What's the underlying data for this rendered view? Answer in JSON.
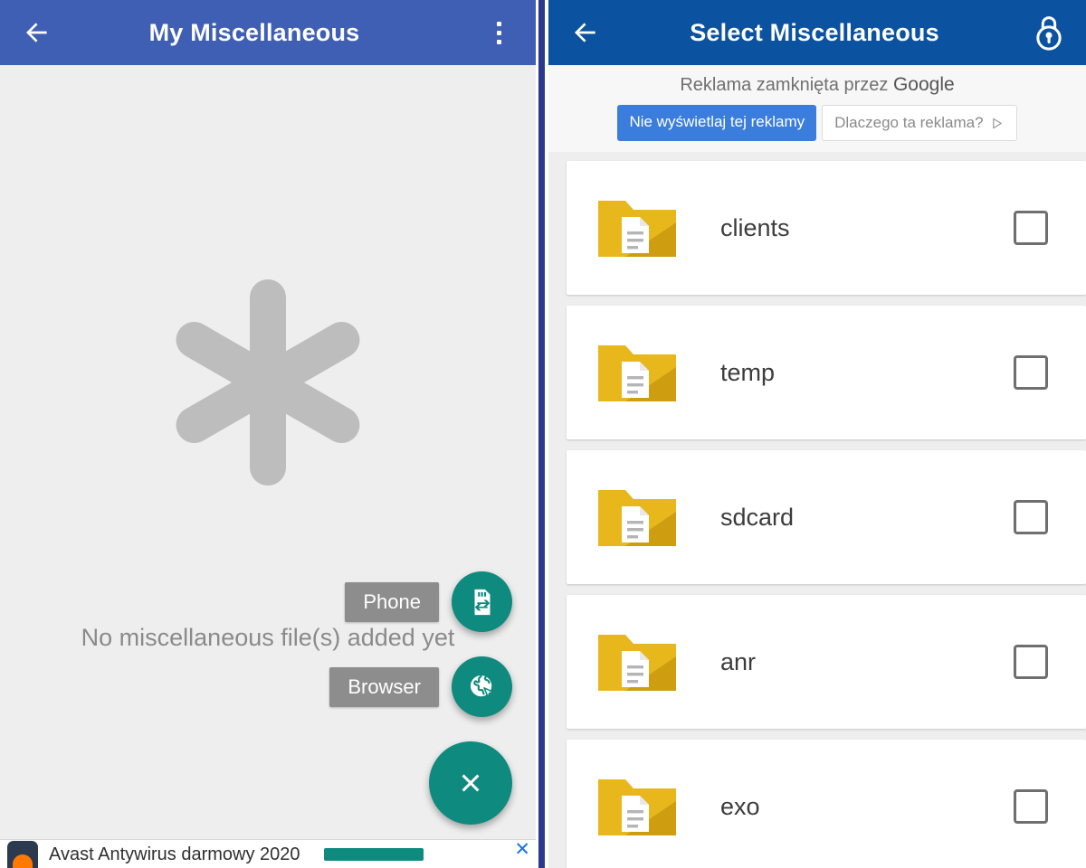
{
  "left": {
    "appbar": {
      "back_icon": "arrow-left-icon",
      "title": "My Miscellaneous",
      "overflow_icon": "more-vert-icon"
    },
    "empty_state": {
      "illustration_icon": "asterisk-icon",
      "message": "No miscellaneous file(s) added yet"
    },
    "fab_menu": {
      "phone_label": "Phone",
      "phone_icon": "sd-card-transfer-icon",
      "browser_label": "Browser",
      "browser_icon": "globe-cursor-icon",
      "close_icon": "close-icon",
      "accent_color": "#0f8a7e"
    },
    "bottom_ad": {
      "title": "Avast Antywirus darmowy 2020",
      "logo_icon": "avast-logo-icon",
      "close_icon": "close-icon"
    },
    "appbar_color": "#3f5fb5"
  },
  "right": {
    "appbar": {
      "back_icon": "arrow-left-icon",
      "title": "Select Miscellaneous",
      "lock_icon": "lock-icon"
    },
    "appbar_color": "#0b52a0",
    "google_ad": {
      "notice": "Reklama zamknięta przez",
      "brand": "Google",
      "block_button": "Nie wyświetlaj tej reklamy",
      "why_button": "Dlaczego ta reklama?",
      "why_icon": "ad-choices-icon"
    },
    "folders": [
      {
        "name": "clients",
        "icon": "folder-document-icon",
        "checked": false
      },
      {
        "name": "temp",
        "icon": "folder-document-icon",
        "checked": false
      },
      {
        "name": "sdcard",
        "icon": "folder-document-icon",
        "checked": false
      },
      {
        "name": "anr",
        "icon": "folder-document-icon",
        "checked": false
      },
      {
        "name": "exo",
        "icon": "folder-document-icon",
        "checked": false
      }
    ]
  },
  "divider_color": "#2b3a8c"
}
